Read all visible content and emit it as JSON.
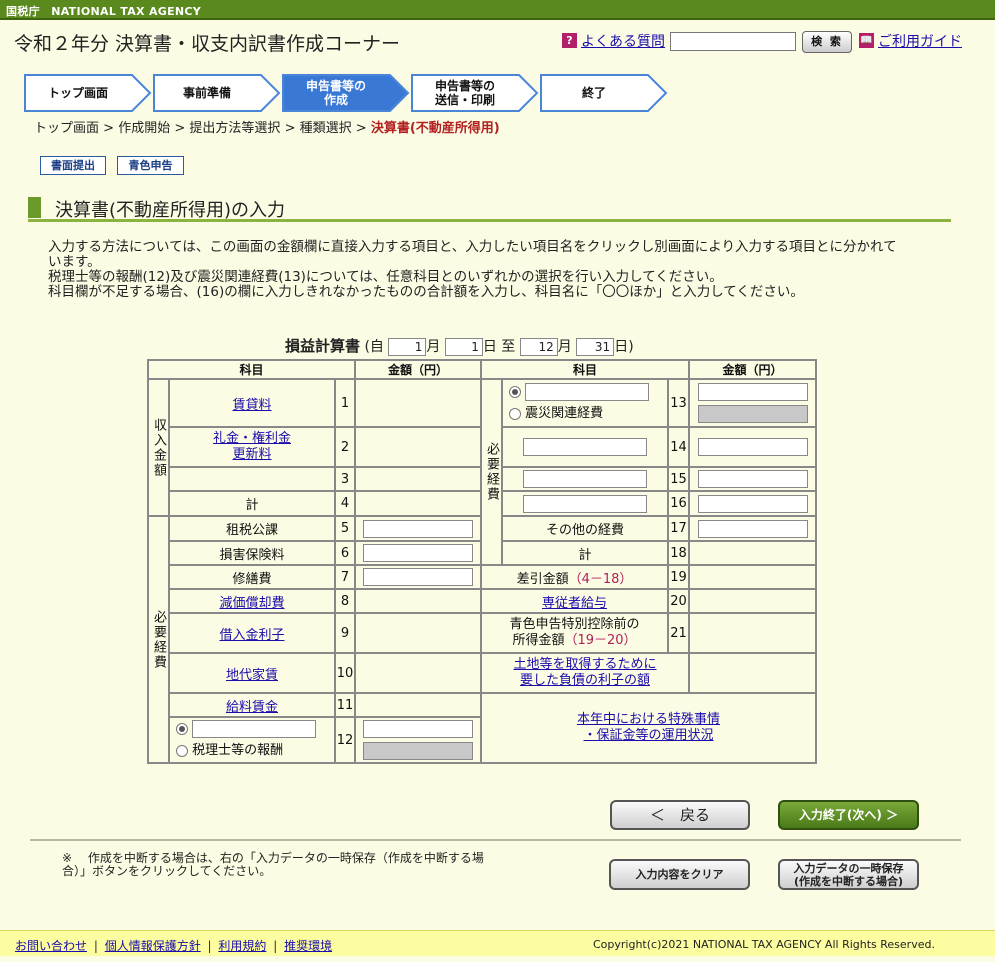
{
  "agency": "国税庁　NATIONAL TAX AGENCY",
  "app_title": "令和２年分 決算書・収支内訳書作成コーナー",
  "header": {
    "faq": "よくある質問",
    "search_button": "検 索",
    "guide": "ご利用ガイド",
    "faq_icon": "?",
    "guide_icon": "📖",
    "search_value": ""
  },
  "steps": [
    {
      "label": "トップ画面",
      "active": false
    },
    {
      "label": "事前準備",
      "active": false
    },
    {
      "label": "申告書等の\n作成",
      "active": true
    },
    {
      "label": "申告書等の\n送信・印刷",
      "active": false
    },
    {
      "label": "終了",
      "active": false
    }
  ],
  "breadcrumb": {
    "items": [
      "トップ画面",
      "作成開始",
      "提出方法等選択",
      "種類選択"
    ],
    "current": "決算書(不動産所得用)",
    "sep": ">"
  },
  "tags": [
    "書面提出",
    "青色申告"
  ],
  "section_title": "決算書(不動産所得用)の入力",
  "description": [
    "入力する方法については、この画面の金額欄に直接入力する項目と、入力したい項目名をクリックし別画面により入力する項目とに分かれています。",
    "税理士等の報酬(12)及び震災関連経費(13)については、任意科目とのいずれかの選択を行い入力してください。",
    "科目欄が不足する場合、(16)の欄に入力しきれなかったものの合計額を入力し、科目名に「〇〇ほか」と入力してください。"
  ],
  "pl": {
    "title": "損益計算書",
    "from": "(自",
    "to": "至",
    "close": ")",
    "month_unit": "月",
    "day_unit": "日",
    "start_month": "1",
    "start_day": "1",
    "end_month": "12",
    "end_day": "31",
    "col_kamoku": "科目",
    "col_amount": "金額（円）",
    "income_group": "収入金額",
    "expense_group": "必要経費",
    "rows": {
      "r1": "賃貸料",
      "r2a": "礼金・権利金",
      "r2b": "更新料",
      "r4": "計",
      "r5": "租税公課",
      "r6": "損害保険料",
      "r7": "修繕費",
      "r8": "減価償却費",
      "r9": "借入金利子",
      "r10": "地代家賃",
      "r11": "給料賃金",
      "r12": "税理士等の報酬",
      "r13": "震災関連経費",
      "r17": "その他の経費",
      "r18": "計",
      "r19": "差引金額",
      "r19n": "（4－18）",
      "r20": "専従者給与",
      "r21a": "青色申告特別控除前の",
      "r21b": "所得金額",
      "r21n": "（19－20）",
      "land_a": "土地等を取得するために",
      "land_b": "要した負債の利子の額",
      "special_a": "本年中における特殊事情",
      "special_b": "・保証金等の運用状況"
    },
    "nums": [
      "1",
      "2",
      "3",
      "4",
      "5",
      "6",
      "7",
      "8",
      "9",
      "10",
      "11",
      "12",
      "13",
      "14",
      "15",
      "16",
      "17",
      "18",
      "19",
      "20",
      "21"
    ]
  },
  "buttons": {
    "back": "＜　戻る",
    "next": "入力終了(次へ) ＞",
    "clear": "入力内容をクリア",
    "save": "入力データの一時保存\n(作成を中断する場合)"
  },
  "note": "※　 作成を中断する場合は、右の「入力データの一時保存（作成を中断する場合）」ボタンをクリックしてください。",
  "footer": {
    "links": [
      "お問い合わせ",
      "個人情報保護方針",
      "利用規約",
      "推奨環境"
    ],
    "copyright": "Copyright(c)2021 NATIONAL TAX AGENCY All Rights Reserved."
  },
  "colors": {
    "accent": "#5a8a1e",
    "active_step": "#3a78d6",
    "step_border": "#4a86d8",
    "link": "#1a0dab",
    "current_crumb": "#b22222",
    "formula": "#b0205a"
  }
}
